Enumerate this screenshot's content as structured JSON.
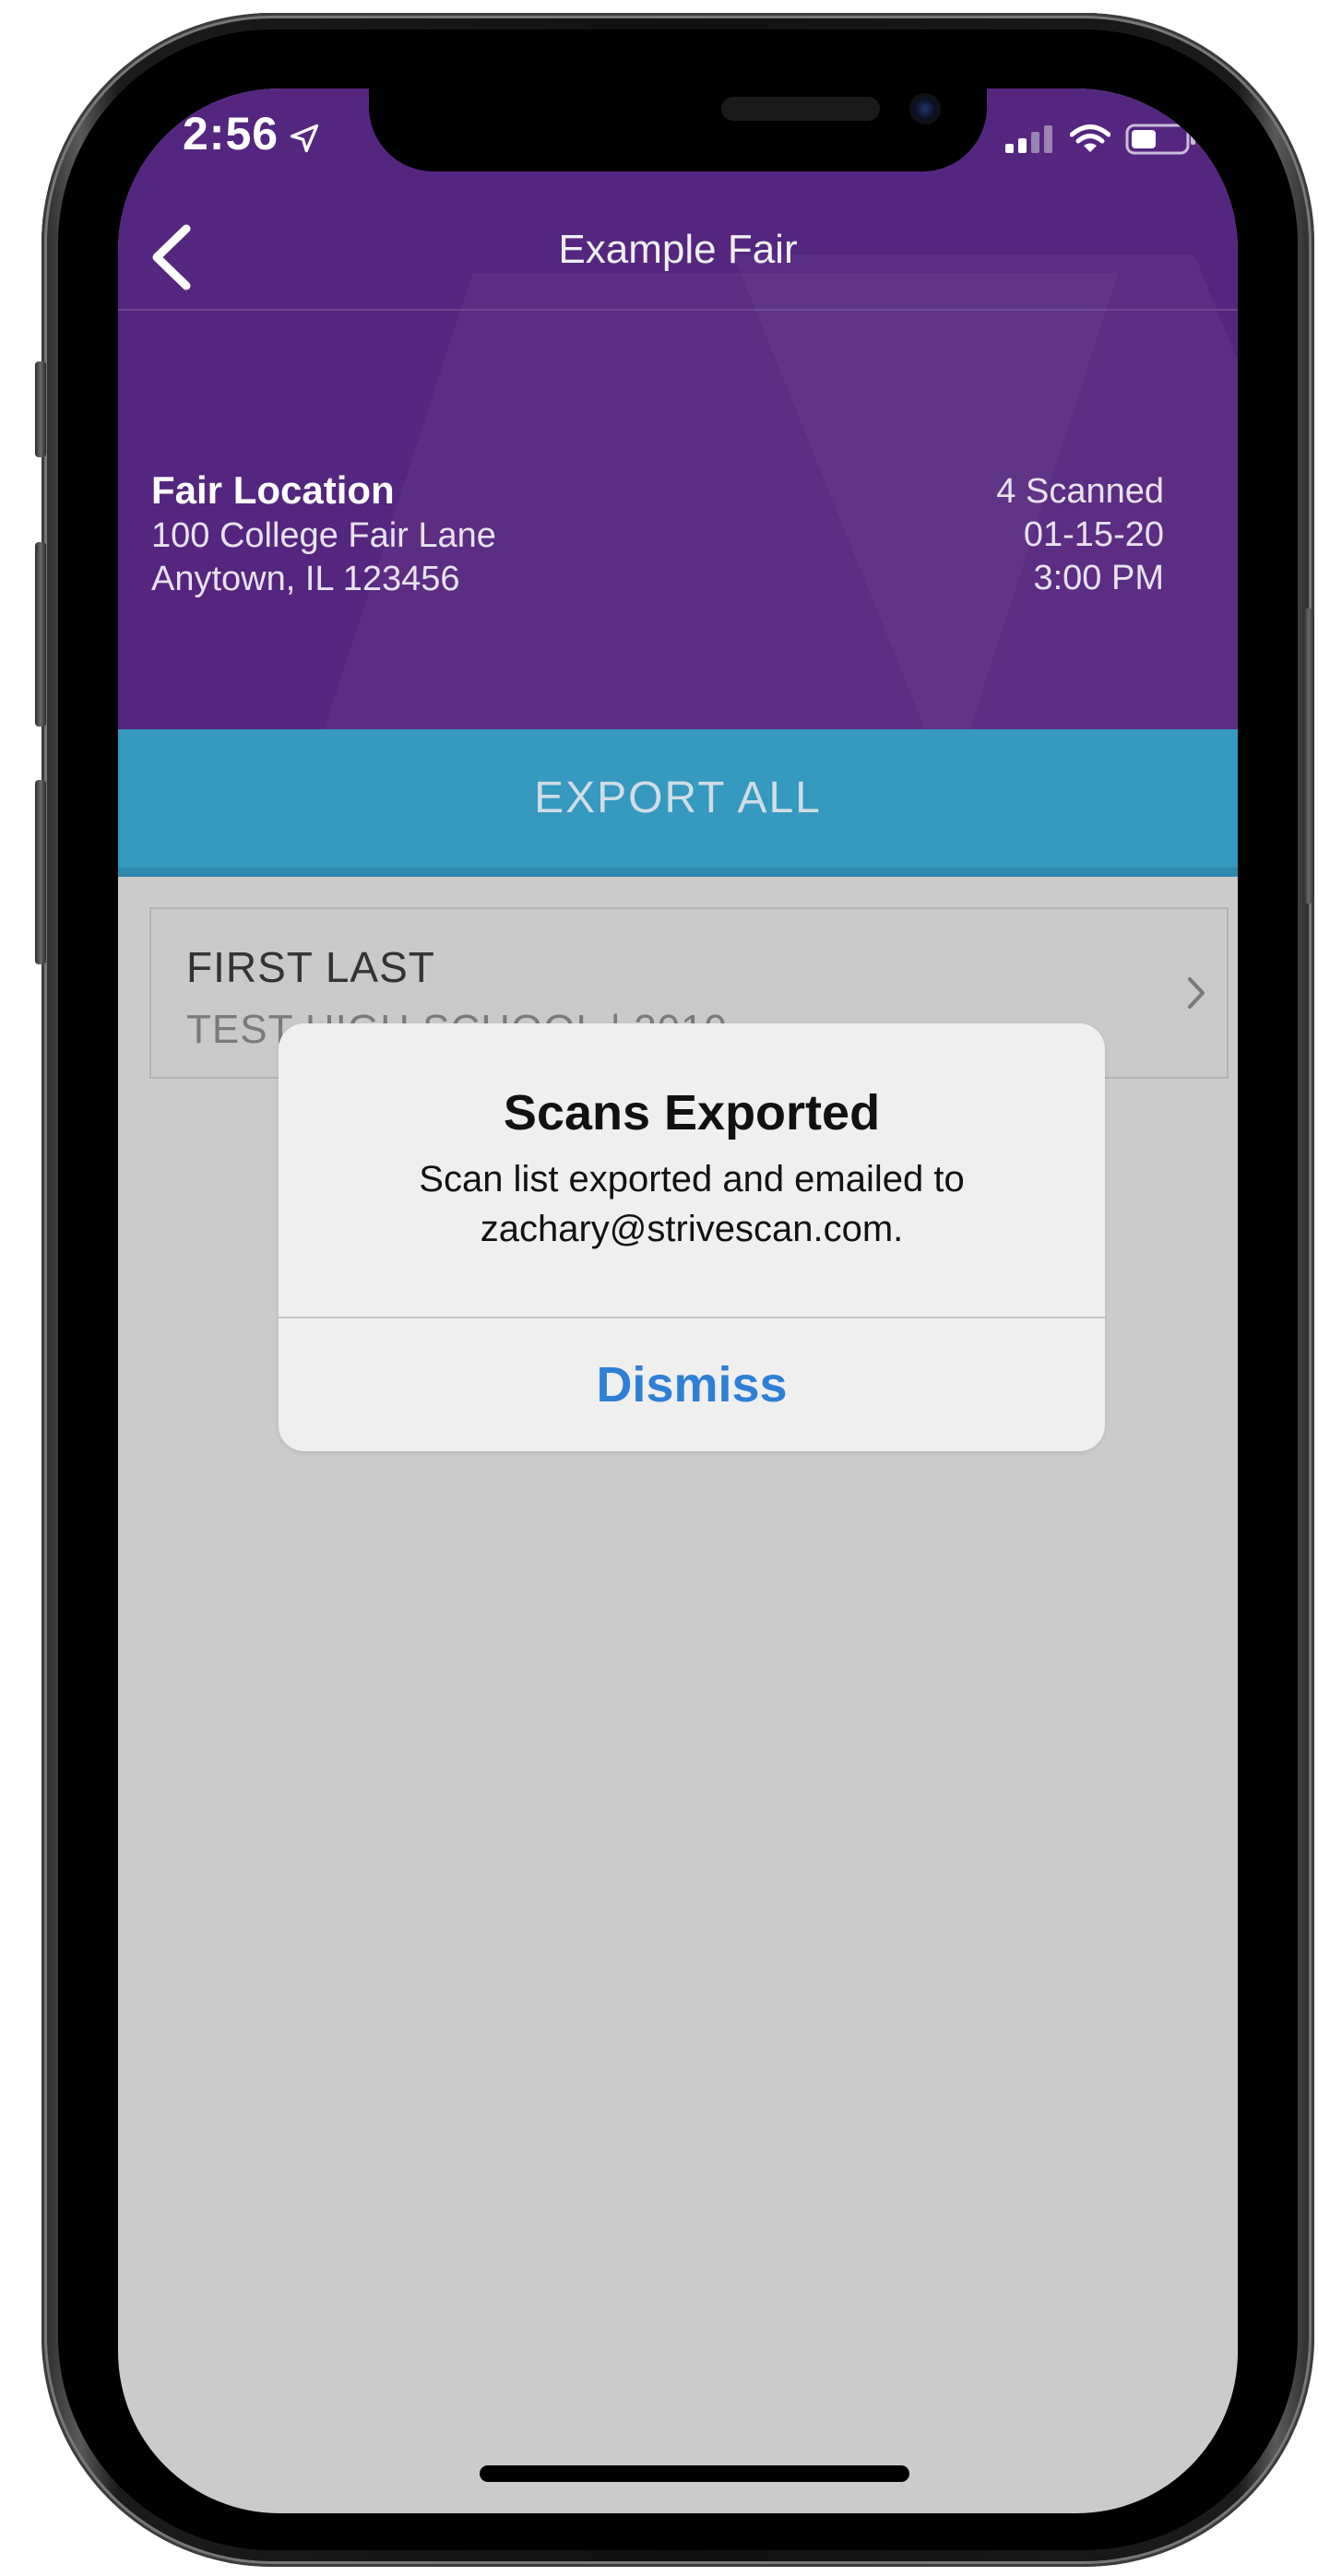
{
  "status_bar": {
    "time": "2:56"
  },
  "nav": {
    "title": "Example Fair"
  },
  "fair": {
    "name": "Fair Location",
    "address_line1": "100 College Fair Lane",
    "address_line2": "Anytown, IL 123456",
    "scanned": "4 Scanned",
    "date": "01-15-20",
    "time": "3:00 PM"
  },
  "export_label": "EXPORT ALL",
  "scans": [
    {
      "name": "FIRST LAST",
      "subtitle": "TEST HIGH SCHOOL | 2019"
    }
  ],
  "alert": {
    "title": "Scans Exported",
    "message_line1": "Scan list exported and emailed to",
    "message_line2": "zachary@strivescan.com.",
    "button": "Dismiss"
  },
  "colors": {
    "header_purple": "#55267f",
    "export_blue": "#3599c0",
    "dim_background": "#cbcbcb",
    "alert_link_blue": "#2f7fd6"
  }
}
